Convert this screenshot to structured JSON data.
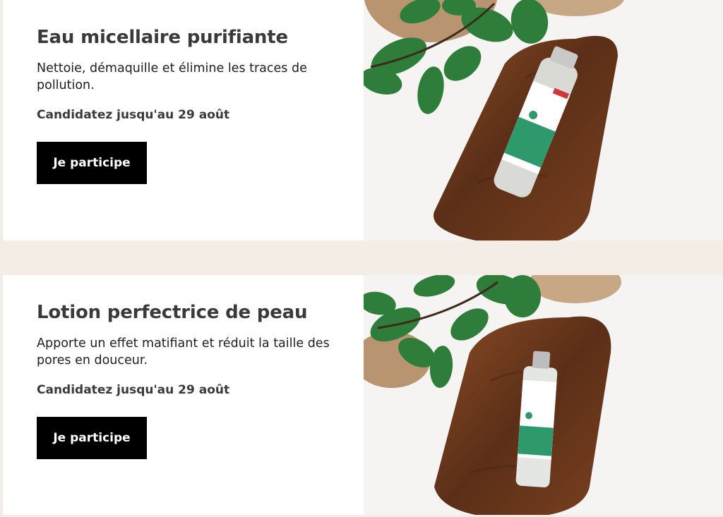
{
  "offers": [
    {
      "title": "Eau micellaire purifiante",
      "description": "Nettoie, démaquille et élimine les traces de pollution.",
      "deadline": "Candidatez jusqu'au 29 août",
      "cta_label": "Je participe",
      "image_icon": "product-photo-icon"
    },
    {
      "title": "Lotion perfectrice de peau",
      "description": "Apporte un effet matifiant et réduit la taille des pores en douceur.",
      "deadline": "Candidatez jusqu'au 29 août",
      "cta_label": "Je participe",
      "image_icon": "product-photo-icon"
    }
  ],
  "colors": {
    "page_background": "#f4ede6",
    "card_background": "#ffffff",
    "button_background": "#000000",
    "button_text": "#ffffff",
    "title_text": "#3a3a3a",
    "wood": "#6b3a1e",
    "label_green": "#2e9a6c"
  }
}
